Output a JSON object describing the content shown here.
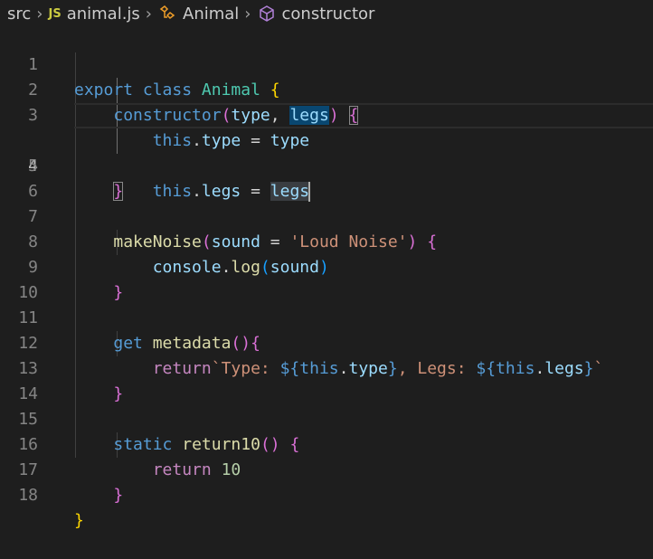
{
  "breadcrumb": {
    "folder": "src",
    "file": "animal.js",
    "file_badge": "JS",
    "class_name": "Animal",
    "member": "constructor"
  },
  "line_numbers": [
    "1",
    "2",
    "3",
    "4",
    "5",
    "6",
    "7",
    "8",
    "9",
    "10",
    "11",
    "12",
    "13",
    "14",
    "15",
    "16",
    "17",
    "18"
  ],
  "active_line": "4",
  "code": {
    "l1": {
      "export": "export",
      "class": "class",
      "name": "Animal",
      "brace": "{"
    },
    "l2": {
      "name": "constructor",
      "open": "(",
      "p1": "type",
      "comma": ", ",
      "p2": "legs",
      "close": ")",
      "brace": "{"
    },
    "l3": {
      "this": "this",
      "dot": ".",
      "prop": "type",
      "eq": " = ",
      "val": "type"
    },
    "l4": {
      "this": "this",
      "dot": ".",
      "prop": "legs",
      "eq": " = ",
      "val": "legs"
    },
    "l5": {
      "brace": "}"
    },
    "l7": {
      "name": "makeNoise",
      "open": "(",
      "param": "sound",
      "eq": " = ",
      "str": "'Loud Noise'",
      "close": ")",
      "brace": "{"
    },
    "l8": {
      "obj": "console",
      "dot": ".",
      "fn": "log",
      "open": "(",
      "arg": "sound",
      "close": ")"
    },
    "l9": {
      "brace": "}"
    },
    "l11": {
      "get": "get",
      "name": "metadata",
      "parens": "()",
      "brace": "{"
    },
    "l12": {
      "ret": "return",
      "s1": "`Type: ",
      "i1o": "${",
      "i1this": "this",
      "i1dot": ".",
      "i1prop": "type",
      "i1c": "}",
      "s2": ", Legs: ",
      "i2o": "${",
      "i2this": "this",
      "i2dot": ".",
      "i2prop": "legs",
      "i2c": "}",
      "s3": "`"
    },
    "l13": {
      "brace": "}"
    },
    "l15": {
      "static": "static",
      "name": "return10",
      "parens": "()",
      "brace": "{"
    },
    "l16": {
      "ret": "return",
      "num": "10"
    },
    "l17": {
      "brace": "}"
    },
    "l18": {
      "brace": "}"
    }
  },
  "colors": {
    "background": "#1e1e1e",
    "keyword": "#569cd6",
    "control": "#c586c0",
    "class": "#4ec9b0",
    "function": "#dcdcaa",
    "variable": "#9cdcfe",
    "string": "#ce9178",
    "number": "#b5cea8",
    "bracket_level1": "#ffd700",
    "bracket_level2": "#da70d6",
    "bracket_level3": "#179fff"
  }
}
